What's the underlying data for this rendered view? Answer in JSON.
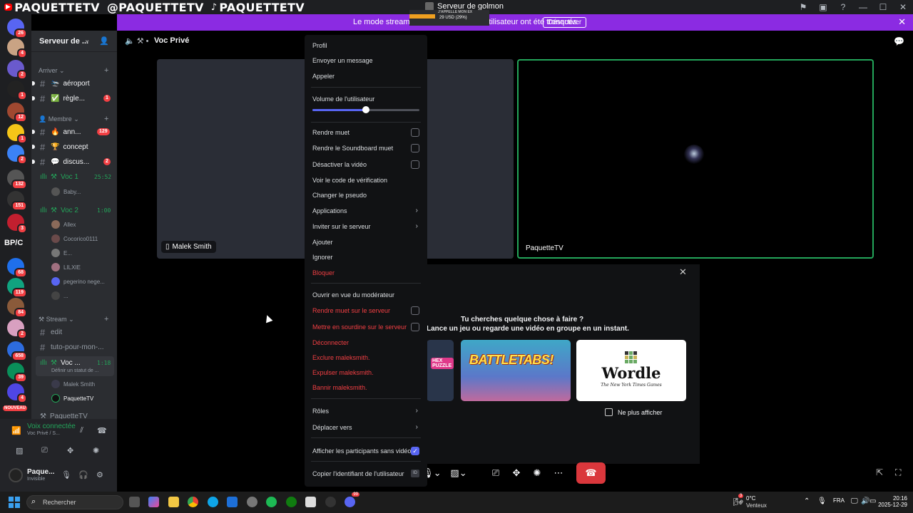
{
  "titlebar": {
    "social_handles": [
      "PAQUETTETV",
      "@PAQUETTETV",
      "PAQUETTETV"
    ],
    "window_title": "Serveur de golmon",
    "overlay_line1": "J'APPELLE MON EX",
    "overlay_line2": "29 USD (29%)"
  },
  "banner": {
    "message": "Le mode streamer est activé. Les … l'utilisateur ont été tronqués.",
    "button": "Désactiver"
  },
  "rail": {
    "badges": [
      "26",
      "4",
      "2",
      "1",
      "12",
      "1",
      "2",
      "132",
      "151",
      "3",
      "68",
      "119",
      "84",
      "2",
      "658",
      "39",
      "4"
    ],
    "text_server": "BP/C",
    "new_label": "NOUVEAU"
  },
  "sidebar": {
    "server_name": "Serveur de ...",
    "categories": {
      "arriver": "Arriver",
      "membre": "Membre",
      "stream": "Stream"
    },
    "channels": [
      {
        "name": "aéroport",
        "emoji": "🛬",
        "badge": ""
      },
      {
        "name": "règle...",
        "emoji": "✅",
        "badge": "1"
      },
      {
        "name": "ann...",
        "emoji": "🔥",
        "badge": "129"
      },
      {
        "name": "concept",
        "emoji": "🏆",
        "badge": ""
      },
      {
        "name": "discus...",
        "emoji": "💬",
        "badge": "2"
      }
    ],
    "voice1": {
      "name": "Voc 1",
      "time": "25:52",
      "users": [
        "Baby..."
      ]
    },
    "voice2": {
      "name": "Voc 2",
      "time": "1:00",
      "users": [
        "Allex",
        "Cocorico0111",
        "E...",
        "LILXIE",
        "pegerino nege...",
        "..."
      ]
    },
    "stream_channels": [
      "edit",
      "tuto-pour-mon-..."
    ],
    "voc_prive": {
      "name": "Voc ...",
      "time": "1:18",
      "status": "Définir un statut de ...",
      "users": [
        "Malek Smith",
        "PaquetteTV"
      ]
    },
    "next_channel": "PaquetteTV"
  },
  "voice_panel": {
    "connected": "Voix connectée",
    "location": "Voc Privé / S..."
  },
  "user_panel": {
    "name": "Paque...",
    "status": "Invisible"
  },
  "stage": {
    "title": "Voc Privé",
    "tile_left_label": "Malek Smith",
    "tile_right_label": "PaquetteTV"
  },
  "activity": {
    "question_line1": "Tu cherches quelque chose à faire ?",
    "question_line2": "Lance un jeu ou regarde une vidéo en groupe en un instant.",
    "games": [
      "HEX PUZZLE",
      "BATTLETABS!",
      "Wordle"
    ],
    "wordle_sub": "The New York Times Games",
    "dont_show": "Ne plus afficher"
  },
  "menu": {
    "profil": "Profil",
    "envoyer": "Envoyer un message",
    "appeler": "Appeler",
    "volume_label": "Volume de l'utilisateur",
    "volume": 0.5,
    "rendre_muet": "Rendre muet",
    "soundboard": "Rendre le Soundboard muet",
    "desactiver_video": "Désactiver la vidéo",
    "code_verif": "Voir le code de vérification",
    "pseudo": "Changer le pseudo",
    "applications": "Applications",
    "inviter": "Inviter sur le serveur",
    "ajouter": "Ajouter",
    "ignorer": "Ignorer",
    "bloquer": "Bloquer",
    "moderateur": "Ouvrir en vue du modérateur",
    "muet_serveur": "Rendre muet sur le serveur",
    "sourdine_serveur": "Mettre en sourdine sur le serveur",
    "deconnecter": "Déconnecter",
    "exclure": "Exclure maleksmith.",
    "expulser": "Expulser maleksmith.",
    "bannir": "Bannir maleksmith.",
    "roles": "Rôles",
    "deplacer": "Déplacer vers",
    "afficher_sans_video": "Afficher les participants sans vidéo",
    "copier_id": "Copier l'identifiant de l'utilisateur",
    "id_icon": "ID"
  },
  "taskbar": {
    "search_placeholder": "Rechercher",
    "temp": "0°C",
    "weather": "Venteux",
    "lang": "FRA",
    "time": "20:16",
    "date": "2025-12-29",
    "weather_badge": "3",
    "discord_badge": "99"
  }
}
